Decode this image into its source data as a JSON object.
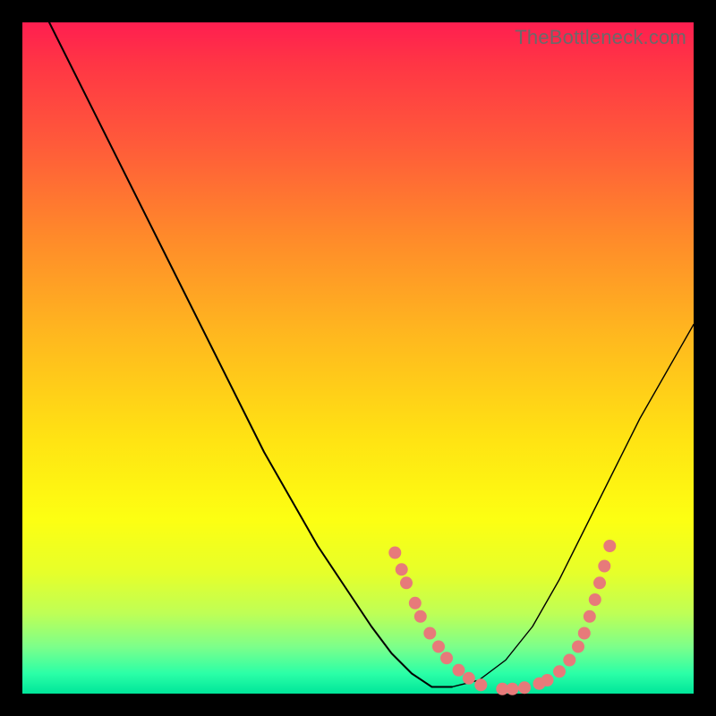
{
  "watermark": "TheBottleneck.com",
  "colors": {
    "marker": "#e77a7a",
    "curve": "#000000",
    "frame_bg_top": "#ff1e50",
    "frame_bg_bottom": "#00e69a",
    "page_bg": "#000000"
  },
  "chart_data": {
    "type": "line",
    "title": "",
    "xlabel": "",
    "ylabel": "",
    "xlim": [
      0,
      100
    ],
    "ylim": [
      0,
      100
    ],
    "grid": false,
    "legend": false,
    "series": [
      {
        "name": "bottleneck-curve",
        "x": [
          4,
          8,
          12,
          16,
          20,
          24,
          28,
          32,
          36,
          40,
          44,
          48,
          52,
          55,
          58,
          61,
          64,
          68,
          72,
          76,
          80,
          84,
          88,
          92,
          96,
          100
        ],
        "y": [
          100,
          92,
          84,
          76,
          68,
          60,
          52,
          44,
          36,
          29,
          22,
          16,
          10,
          6,
          3,
          1,
          1,
          2,
          5,
          10,
          17,
          25,
          33,
          41,
          48,
          55
        ]
      }
    ],
    "markers": {
      "name": "highlight-dots",
      "points": [
        {
          "x": 55.5,
          "y": 21.0
        },
        {
          "x": 56.5,
          "y": 18.5
        },
        {
          "x": 57.2,
          "y": 16.5
        },
        {
          "x": 58.5,
          "y": 13.5
        },
        {
          "x": 59.3,
          "y": 11.5
        },
        {
          "x": 60.7,
          "y": 9.0
        },
        {
          "x": 62.0,
          "y": 7.0
        },
        {
          "x": 63.2,
          "y": 5.3
        },
        {
          "x": 65.0,
          "y": 3.5
        },
        {
          "x": 66.5,
          "y": 2.3
        },
        {
          "x": 68.3,
          "y": 1.3
        },
        {
          "x": 71.5,
          "y": 0.7
        },
        {
          "x": 73.0,
          "y": 0.7
        },
        {
          "x": 74.8,
          "y": 0.9
        },
        {
          "x": 77.0,
          "y": 1.5
        },
        {
          "x": 78.2,
          "y": 2.0
        },
        {
          "x": 80.0,
          "y": 3.3
        },
        {
          "x": 81.5,
          "y": 5.0
        },
        {
          "x": 82.8,
          "y": 7.0
        },
        {
          "x": 83.7,
          "y": 9.0
        },
        {
          "x": 84.5,
          "y": 11.5
        },
        {
          "x": 85.3,
          "y": 14.0
        },
        {
          "x": 86.0,
          "y": 16.5
        },
        {
          "x": 86.7,
          "y": 19.0
        },
        {
          "x": 87.5,
          "y": 22.0
        }
      ]
    }
  }
}
